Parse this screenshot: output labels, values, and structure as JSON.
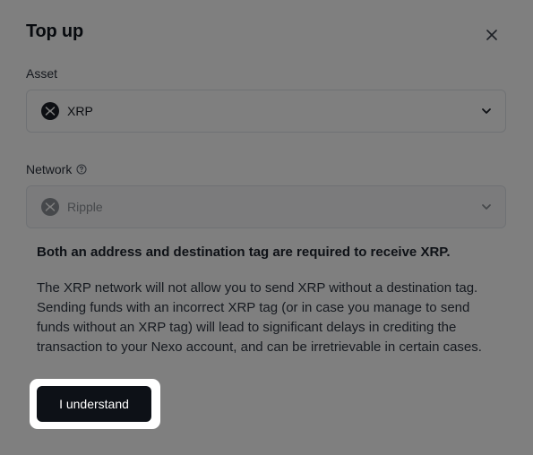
{
  "dialog": {
    "title": "Top up",
    "close_icon": "close-icon"
  },
  "asset": {
    "label": "Asset",
    "value": "XRP",
    "icon": "xrp-coin-icon"
  },
  "network": {
    "label": "Network",
    "help_icon": "help-circle-icon",
    "value": "Ripple",
    "icon": "xrp-coin-icon"
  },
  "warning": {
    "title": "Both an address and destination tag are required to receive XRP.",
    "body": "The XRP network will not allow you to send XRP without a destination tag. Sending funds with an incorrect XRP tag (or in case you manage to send funds without an XRP tag) will lead to significant delays in crediting the transaction to your Nexo account, and can be irretrievable in certain cases."
  },
  "confirm": {
    "label": "I understand"
  },
  "colors": {
    "button_bg": "#0d1117",
    "overlay": "rgba(0,0,0,0.5)"
  }
}
